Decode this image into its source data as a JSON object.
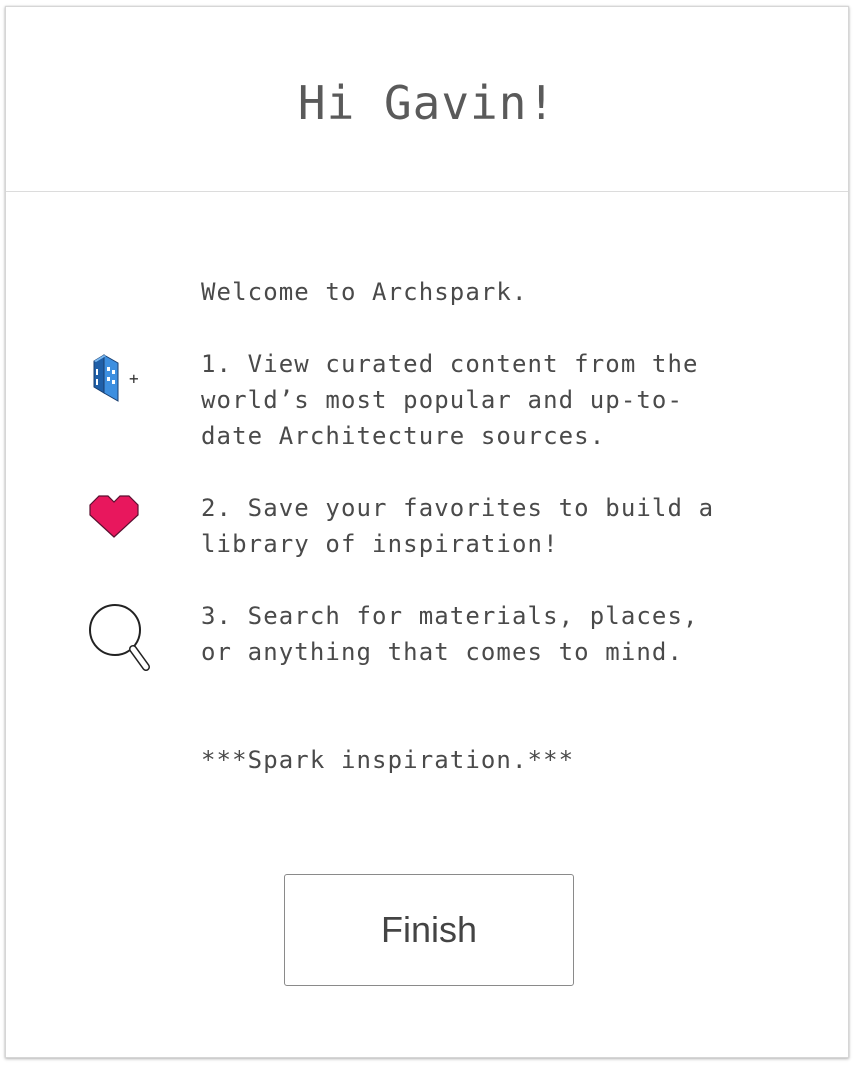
{
  "header": {
    "greeting": "Hi Gavin!"
  },
  "content": {
    "welcome": "Welcome to Archspark.",
    "steps": [
      {
        "icon": "building-plus-icon",
        "lines": [
          "1. View curated content from the",
          "world’s most popular and up-to-",
          "date Architecture sources."
        ]
      },
      {
        "icon": "heart-icon",
        "lines": [
          "2. Save your favorites to build a",
          "library of inspiration!"
        ]
      },
      {
        "icon": "search-icon",
        "lines": [
          "3. Search for materials, places,",
          "or anything that comes to mind."
        ]
      }
    ],
    "step_icon_plus": "+",
    "tagline": "***Spark inspiration.***"
  },
  "footer": {
    "finish_label": "Finish"
  },
  "colors": {
    "heart": "#e8175d",
    "building": "#2f7fd0",
    "text": "#4a4a4a"
  }
}
